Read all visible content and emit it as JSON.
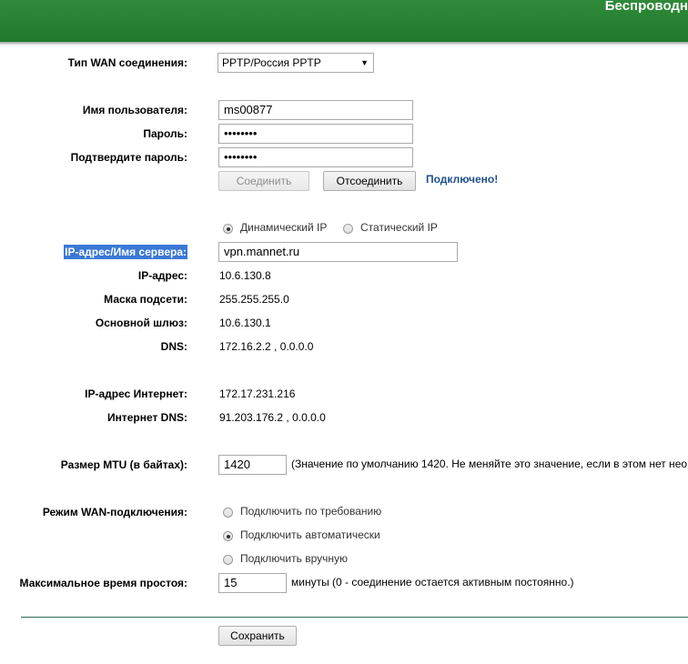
{
  "header": {
    "title": "Беспроводн"
  },
  "wan": {
    "type_label": "Тип WAN соединения:",
    "type_value": "PPTP/Россия PPTP",
    "username_label": "Имя пользователя:",
    "username_value": "ms00877",
    "password_label": "Пароль:",
    "password_value": "••••••••",
    "confirm_label": "Подтвердите пароль:",
    "confirm_value": "••••••••",
    "connect_label": "Соединить",
    "disconnect_label": "Отсоединить",
    "status": "Подключено!"
  },
  "ip": {
    "dynamic_label": "Динамический IP",
    "static_label": "Статический IP",
    "selected": "dynamic",
    "server_label": "IP-адрес/Имя сервера:",
    "server_value": "vpn.mannet.ru",
    "ip_label": "IP-адрес:",
    "ip_value": "10.6.130.8",
    "mask_label": "Маска подсети:",
    "mask_value": "255.255.255.0",
    "gateway_label": "Основной шлюз:",
    "gateway_value": "10.6.130.1",
    "dns_label": "DNS:",
    "dns_value": "172.16.2.2 , 0.0.0.0",
    "inet_ip_label": "IP-адрес Интернет:",
    "inet_ip_value": "172.17.231.216",
    "inet_dns_label": "Интернет DNS:",
    "inet_dns_value": "91.203.176.2 , 0.0.0.0"
  },
  "mtu": {
    "label": "Размер MTU (в байтах):",
    "value": "1420",
    "note": "(Значение по умолчанию 1420. Не меняйте это значение, если в этом нет нео"
  },
  "mode": {
    "label": "Режим WAN-подключения:",
    "options": [
      "Подключить по требованию",
      "Подключить автоматически",
      "Подключить вручную"
    ],
    "selected_index": 1,
    "idle_label": "Максимальное время простоя:",
    "idle_value": "15",
    "idle_note": "минуты (0 - соединение остается активным постоянно.)"
  },
  "actions": {
    "save_label": "Сохранить"
  },
  "colors": {
    "header_green": "#1e7a2a",
    "status_blue": "#1f4f8a",
    "highlight": "#3a78d6"
  }
}
